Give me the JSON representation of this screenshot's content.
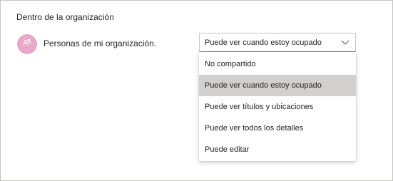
{
  "section": {
    "title": "Dentro de la organización"
  },
  "row": {
    "avatar_icon": "people-icon",
    "avatar_color": "#e7a8c9",
    "label": "Personas de mi organización."
  },
  "permission_select": {
    "value": "Puede ver cuando estoy ocupado",
    "chevron_icon": "chevron-down-icon",
    "options": [
      {
        "label": "No compartido",
        "selected": false
      },
      {
        "label": "Puede ver cuando estoy ocupado",
        "selected": true
      },
      {
        "label": "Puede ver títulos y ubicaciones",
        "selected": false
      },
      {
        "label": "Puede ver todos los detalles",
        "selected": false
      },
      {
        "label": "Puede editar",
        "selected": false
      }
    ]
  },
  "colors": {
    "selected_option_bg": "#d2d0ce",
    "border": "#c8c6c4"
  }
}
